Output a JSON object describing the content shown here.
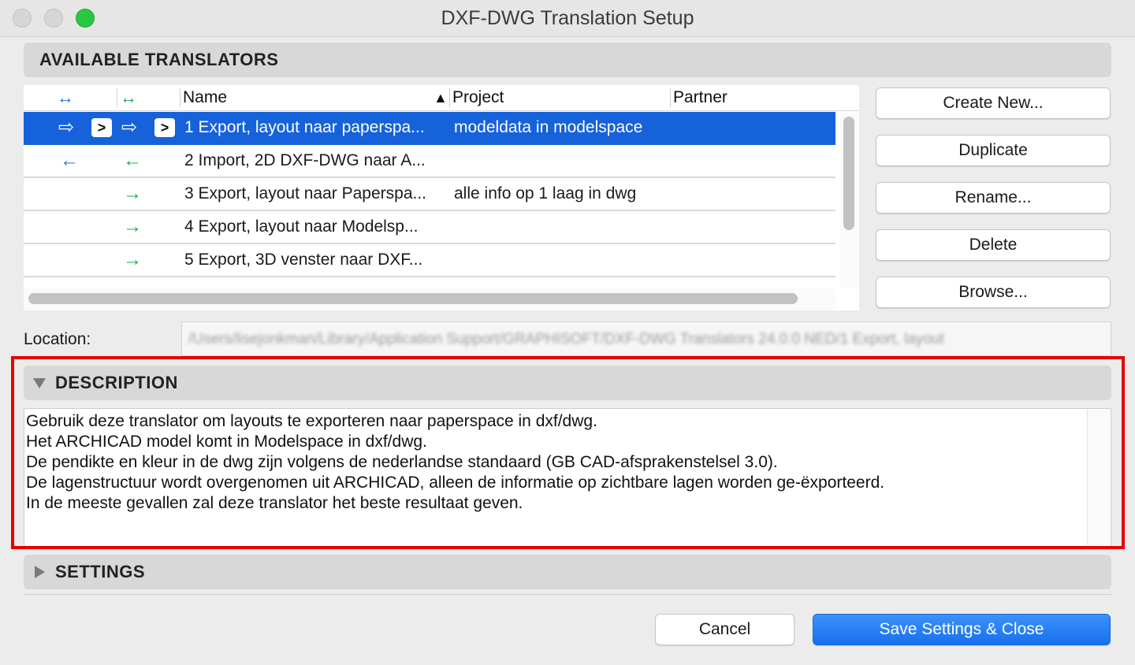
{
  "window": {
    "title": "DXF-DWG Translation Setup",
    "traffic_lights": [
      "#ccc",
      "#ccc",
      "#28c840"
    ]
  },
  "available": {
    "header": "AVAILABLE TRANSLATORS",
    "columns": {
      "export_icon": "↔",
      "import_icon": "↔",
      "name": "Name",
      "sort_icon": "▲",
      "project": "Project",
      "partner": "Partner"
    },
    "rows": [
      {
        "export": "⇨",
        "export_chevron": ">",
        "import": "⇨",
        "import_chevron": ">",
        "name": "1 Export, layout naar paperspa...",
        "project": "modeldata in modelspace",
        "partner": "",
        "selected": true
      },
      {
        "export": "←",
        "import": "←",
        "name": "2 Import, 2D DXF-DWG naar A...",
        "project": "",
        "partner": ""
      },
      {
        "export": "",
        "import": "→",
        "name": "3 Export, layout naar Paperspa...",
        "project": "alle info op 1 laag in dwg",
        "partner": ""
      },
      {
        "export": "",
        "import": "→",
        "name": "4 Export, layout naar Modelsp...",
        "project": "",
        "partner": ""
      },
      {
        "export": "",
        "import": "→",
        "name": "5 Export, 3D venster naar DXF...",
        "project": "",
        "partner": ""
      }
    ]
  },
  "buttons": {
    "create_new": "Create New...",
    "duplicate": "Duplicate",
    "rename": "Rename...",
    "delete": "Delete",
    "browse": "Browse..."
  },
  "location": {
    "label": "Location:",
    "value": "/Users/lisejonkman/Library/Application Support/GRAPHISOFT/DXF-DWG Translators 24.0.0 NED/1 Export, layout"
  },
  "description": {
    "header": "DESCRIPTION",
    "lines": [
      "Gebruik deze translator om layouts te exporteren naar paperspace in dxf/dwg.",
      "Het ARCHICAD model komt in Modelspace in dxf/dwg.",
      "De pendikte en kleur in de dwg zijn volgens de nederlandse standaard (GB CAD-afsprakenstelsel 3.0).",
      "De lagenstructuur wordt overgenomen uit ARCHICAD, alleen de informatie op zichtbare lagen worden ge-ëxporteerd.",
      "In de meeste gevallen zal deze translator het beste resultaat geven."
    ]
  },
  "settings": {
    "header": "SETTINGS"
  },
  "footer": {
    "cancel": "Cancel",
    "save": "Save Settings & Close"
  },
  "colors": {
    "accent": "#1662db",
    "export_arrow": "#1e6fe0",
    "import_arrow": "#18a84a",
    "highlight": "#e60000"
  }
}
